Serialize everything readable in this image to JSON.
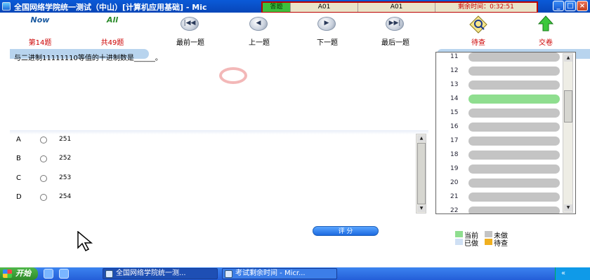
{
  "window": {
    "title": "全国网络学院统一测试（中山）[计算机应用基础] - Mic",
    "minimize_label": "_",
    "maximize_label": "□",
    "close_label": "×"
  },
  "timer": {
    "status": "答题",
    "field1": "A01",
    "field2": "A01",
    "remaining": "剩余时间：0:32:51"
  },
  "toolbar": {
    "now_icon_text": "Now",
    "all_icon_text": "All",
    "current_label": "第14题",
    "total_label": "共49题",
    "first_label": "最前一题",
    "prev_label": "上一题",
    "next_label": "下一题",
    "last_label": "最后一题",
    "review_label": "待查",
    "submit_label": "交卷"
  },
  "question": {
    "text": "与二进制11111110等值的十进制数是______。"
  },
  "options": [
    {
      "letter": "A",
      "value": "251"
    },
    {
      "letter": "B",
      "value": "252"
    },
    {
      "letter": "C",
      "value": "253"
    },
    {
      "letter": "D",
      "value": "254"
    }
  ],
  "score_button": "评 分",
  "question_list": {
    "numbers": [
      "11",
      "12",
      "13",
      "14",
      "15",
      "16",
      "17",
      "18",
      "19",
      "20",
      "21",
      "22"
    ],
    "current": "14"
  },
  "legend": {
    "current": "当前",
    "not_done": "未做",
    "done": "已做",
    "review": "待查"
  },
  "colors": {
    "current": "#8fde8f",
    "not_done": "#c4c4c4",
    "done": "#cfe0f4",
    "review": "#f0b020"
  },
  "taskbar": {
    "start_label": "开始",
    "task1": "全国网络学院统一测...",
    "task2": "考试剩余时间 - Micr...",
    "tray_label": "«"
  }
}
